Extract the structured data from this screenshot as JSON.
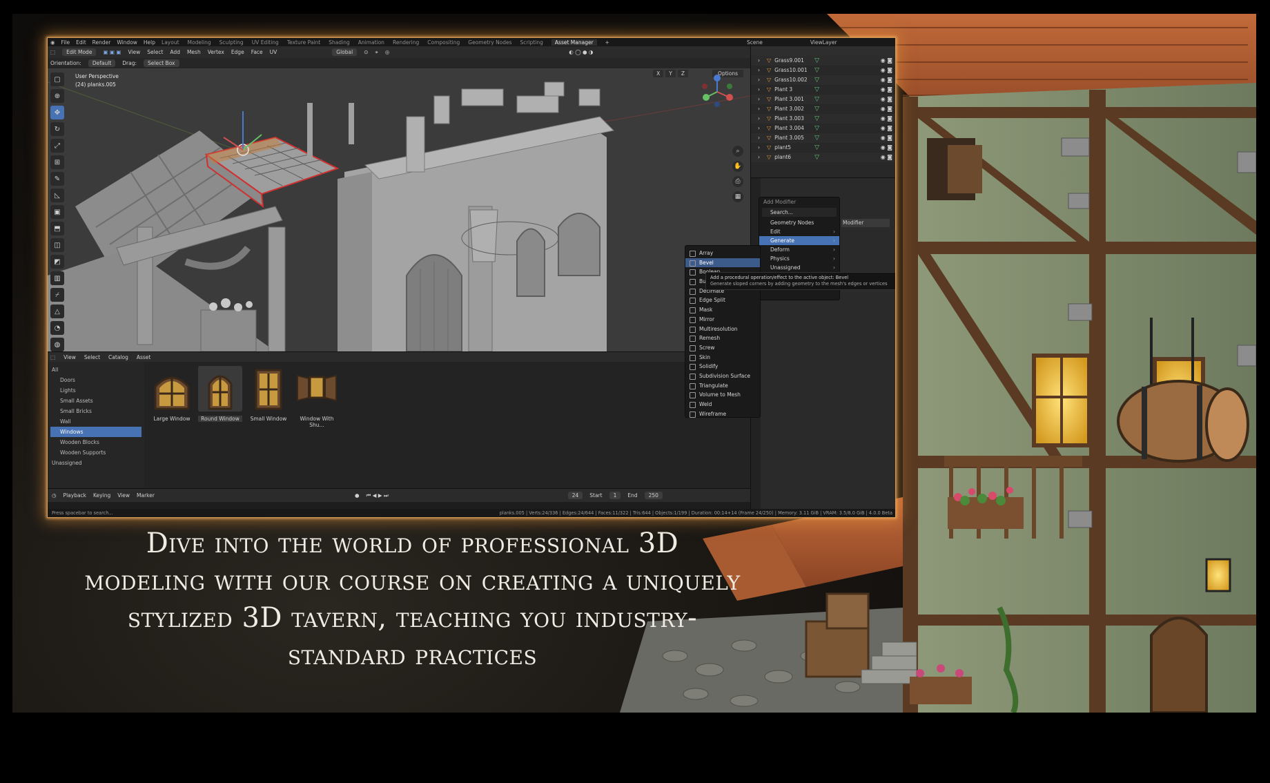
{
  "caption": "Dive into the world of professional 3D modeling with our course on creating a uniquely stylized 3D tavern, teaching you industry-standard practices",
  "menu": [
    "File",
    "Edit",
    "Render",
    "Window",
    "Help"
  ],
  "workspaces": [
    "Layout",
    "Modeling",
    "Sculpting",
    "UV Editing",
    "Texture Paint",
    "Shading",
    "Animation",
    "Rendering",
    "Compositing",
    "Geometry Nodes",
    "Scripting",
    "Asset Manager"
  ],
  "active_workspace": "Asset Manager",
  "scene_label": "Scene",
  "viewlayer_label": "ViewLayer",
  "header": {
    "mode": "Edit Mode",
    "menus": [
      "View",
      "Select",
      "Add",
      "Mesh",
      "Vertex",
      "Edge",
      "Face",
      "UV"
    ],
    "transform": "Global"
  },
  "header2": {
    "orientation_label": "Orientation:",
    "orientation_value": "Default",
    "drag_label": "Drag:",
    "drag_value": "Select Box"
  },
  "viewport": {
    "view_name": "User Perspective",
    "object_info": "(24) planks.005",
    "axes": [
      "X",
      "Y",
      "Z"
    ],
    "options": "Options"
  },
  "outliner": {
    "rows": [
      {
        "name": "Grass9.001"
      },
      {
        "name": "Grass10.001"
      },
      {
        "name": "Grass10.002"
      },
      {
        "name": "Plant 3"
      },
      {
        "name": "Plant 3.001"
      },
      {
        "name": "Plant 3.002"
      },
      {
        "name": "Plant 3.003"
      },
      {
        "name": "Plant 3.004"
      },
      {
        "name": "Plant 3.005"
      },
      {
        "name": "plant5"
      },
      {
        "name": "plant6"
      }
    ]
  },
  "add_modifier": {
    "title": "Add Modifier",
    "search": "Search...",
    "items": [
      {
        "label": "Geometry Nodes",
        "submenu": false
      },
      {
        "label": "Edit",
        "submenu": true
      },
      {
        "label": "Generate",
        "submenu": true
      },
      {
        "label": "Deform",
        "submenu": true
      },
      {
        "label": "Physics",
        "submenu": true
      },
      {
        "label": "Unassigned",
        "submenu": true
      }
    ],
    "partial_label": "Modifier"
  },
  "generate_menu": [
    "Array",
    "Bevel",
    "Boolean",
    "Build",
    "Decimate",
    "Edge Split",
    "Mask",
    "Mirror",
    "Multiresolution",
    "Remesh",
    "Screw",
    "Skin",
    "Solidify",
    "Subdivision Surface",
    "Triangulate",
    "Volume to Mesh",
    "Weld",
    "Wireframe"
  ],
  "tooltip": {
    "line1": "Add a procedural operation/effect to the active object:  Bevel",
    "line2": "Generate sloped corners by adding geometry to the mesh's edges or vertices"
  },
  "asset_browser": {
    "menus": [
      "View",
      "Select",
      "Catalog",
      "Asset"
    ],
    "catalogs": [
      "All",
      "Doors",
      "Lights",
      "Small Assets",
      "Small Bricks",
      "Wall",
      "Windows",
      "Wooden Blocks",
      "Wooden Supports",
      "Unassigned"
    ],
    "selected_catalog": "Windows",
    "assets": [
      {
        "name": "Large Window"
      },
      {
        "name": "Round Window"
      },
      {
        "name": "Small Window"
      },
      {
        "name": "Window With Shu..."
      }
    ]
  },
  "timeline": {
    "menus": [
      "Playback",
      "Keying",
      "View",
      "Marker"
    ],
    "current_frame": "24",
    "start_label": "Start",
    "start": "1",
    "end_label": "End",
    "end": "250"
  },
  "statusbar": {
    "left": "Press spacebar to search...",
    "right": "planks.005 | Verts:24/336 | Edges:24/644 | Faces:11/322 | Tris:644 | Objects:1/199 | Duration: 00:14+14 (Frame 24/250) | Memory: 3.11 GiB | VRAM: 3.5/8.0 GiB | 4.0.0 Beta"
  },
  "colors": {
    "selection": "#4772b3",
    "window_glow": "#d39a55",
    "edit_edges": "#e03030"
  }
}
